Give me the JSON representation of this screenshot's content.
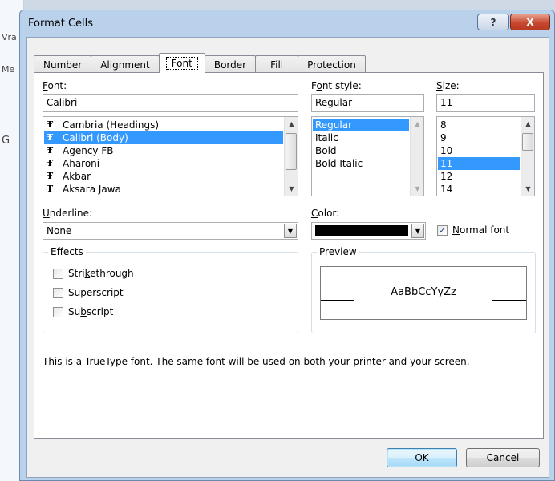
{
  "background": {
    "fragments": [
      "Vra",
      "Me",
      "G"
    ]
  },
  "dialog": {
    "title": "Format Cells",
    "help_label": "?",
    "close_label": "X"
  },
  "tabs": [
    {
      "label": "Number"
    },
    {
      "label": "Alignment"
    },
    {
      "label": "Font"
    },
    {
      "label": "Border"
    },
    {
      "label": "Fill"
    },
    {
      "label": "Protection"
    }
  ],
  "active_tab": "Font",
  "font": {
    "label_pre": "",
    "label_u": "F",
    "label_post": "ont:",
    "value": "Calibri",
    "items": [
      "Cambria (Headings)",
      "Calibri (Body)",
      "Agency FB",
      "Aharoni",
      "Akbar",
      "Aksara Jawa"
    ],
    "selected": "Calibri (Body)",
    "tt_glyph": "Ŧ"
  },
  "font_style": {
    "label_pre": "F",
    "label_u": "o",
    "label_post": "nt style:",
    "value": "Regular",
    "items": [
      "Regular",
      "Italic",
      "Bold",
      "Bold Italic"
    ],
    "selected": "Regular"
  },
  "size": {
    "label_pre": "",
    "label_u": "S",
    "label_post": "ize:",
    "value": "11",
    "items": [
      "8",
      "9",
      "10",
      "11",
      "12",
      "14"
    ],
    "selected": "11"
  },
  "underline": {
    "label_pre": "",
    "label_u": "U",
    "label_post": "nderline:",
    "value": "None"
  },
  "color": {
    "label_pre": "",
    "label_u": "C",
    "label_post": "olor:",
    "swatch": "#000000"
  },
  "normal_font": {
    "checked": true,
    "label_pre": "",
    "label_u": "N",
    "label_post": "ormal font"
  },
  "effects": {
    "title": "Effects",
    "strikethrough": {
      "pre": "Stri",
      "u": "k",
      "post": "ethrough",
      "checked": false
    },
    "superscript": {
      "pre": "Sup",
      "u": "e",
      "post": "rscript",
      "checked": false
    },
    "subscript": {
      "pre": "Su",
      "u": "b",
      "post": "script",
      "checked": false
    }
  },
  "preview": {
    "title": "Preview",
    "sample": "AaBbCcYyZz"
  },
  "info_text": "This is a TrueType font.  The same font will be used on both your printer and your screen.",
  "buttons": {
    "ok": "OK",
    "cancel": "Cancel"
  }
}
